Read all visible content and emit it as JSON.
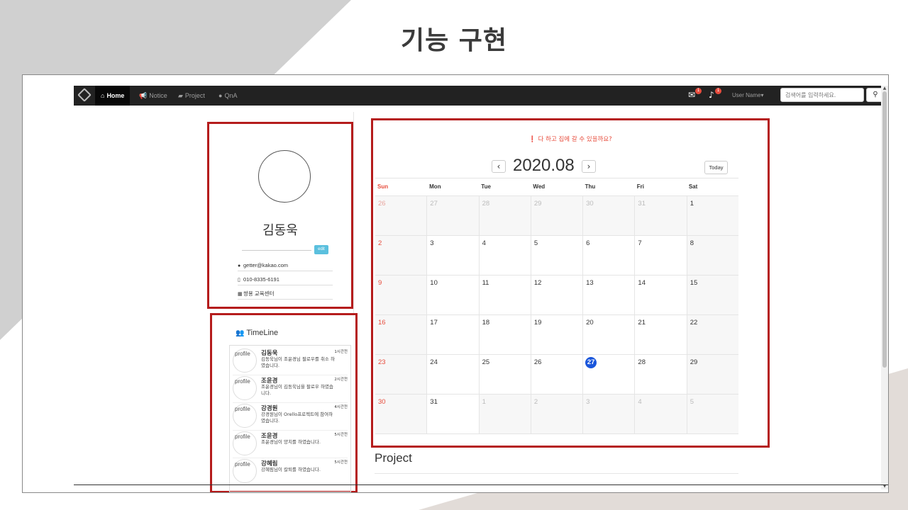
{
  "slide": {
    "title": "기능 구현"
  },
  "navbar": {
    "home": "Home",
    "notice": "Notice",
    "project": "Project",
    "qna": "QnA",
    "mail_badge": "1",
    "bell_badge": "1",
    "user_name": "User Name",
    "search_placeholder": "검색어를 입력하세요."
  },
  "profile": {
    "name": "김동욱",
    "edit_label": "edit",
    "email": "getter@kakao.com",
    "phone": "010-8335-6191",
    "org": "쌍용 교육센터"
  },
  "timeline": {
    "title": "TimeLine",
    "items": [
      {
        "avatar_alt": "profile",
        "name": "김동욱",
        "time": "1시간전",
        "message": "김동욱님이 조윤경님 팔로우를 취소 하였습니다."
      },
      {
        "avatar_alt": "profile",
        "name": "조윤경",
        "time": "2시간전",
        "message": "조윤경님이 김동욱님을 팔로우 하였습니다."
      },
      {
        "avatar_alt": "profile",
        "name": "강경원",
        "time": "4시간전",
        "message": "강경원님이 Orello프로젝트에 참여하였습니다."
      },
      {
        "avatar_alt": "profile",
        "name": "조윤경",
        "time": "5시간전",
        "message": "조윤경님이 양치를 하였습니다."
      },
      {
        "avatar_alt": "profile",
        "name": "강혜림",
        "time": "5시간전",
        "message": "강혜림님이 칼퇴를 하였습니다."
      }
    ]
  },
  "calendar": {
    "alert": "다 하고 집에 갈 수 있을까요?",
    "month_title": "2020.08",
    "prev_label": "‹",
    "next_label": "›",
    "today_label": "Today",
    "days_of_week": [
      "Sun",
      "Mon",
      "Tue",
      "Wed",
      "Thu",
      "Fri",
      "Sat"
    ],
    "weeks": [
      [
        "26",
        "27",
        "28",
        "29",
        "30",
        "31",
        "1"
      ],
      [
        "2",
        "3",
        "4",
        "5",
        "6",
        "7",
        "8"
      ],
      [
        "9",
        "10",
        "11",
        "12",
        "13",
        "14",
        "15"
      ],
      [
        "16",
        "17",
        "18",
        "19",
        "20",
        "21",
        "22"
      ],
      [
        "23",
        "24",
        "25",
        "26",
        "27",
        "28",
        "29"
      ],
      [
        "30",
        "31",
        "1",
        "2",
        "3",
        "4",
        "5"
      ]
    ],
    "today": "27",
    "accent_color": "#1a56db",
    "sunday_color": "#e74c3c"
  },
  "project": {
    "title": "Project"
  }
}
